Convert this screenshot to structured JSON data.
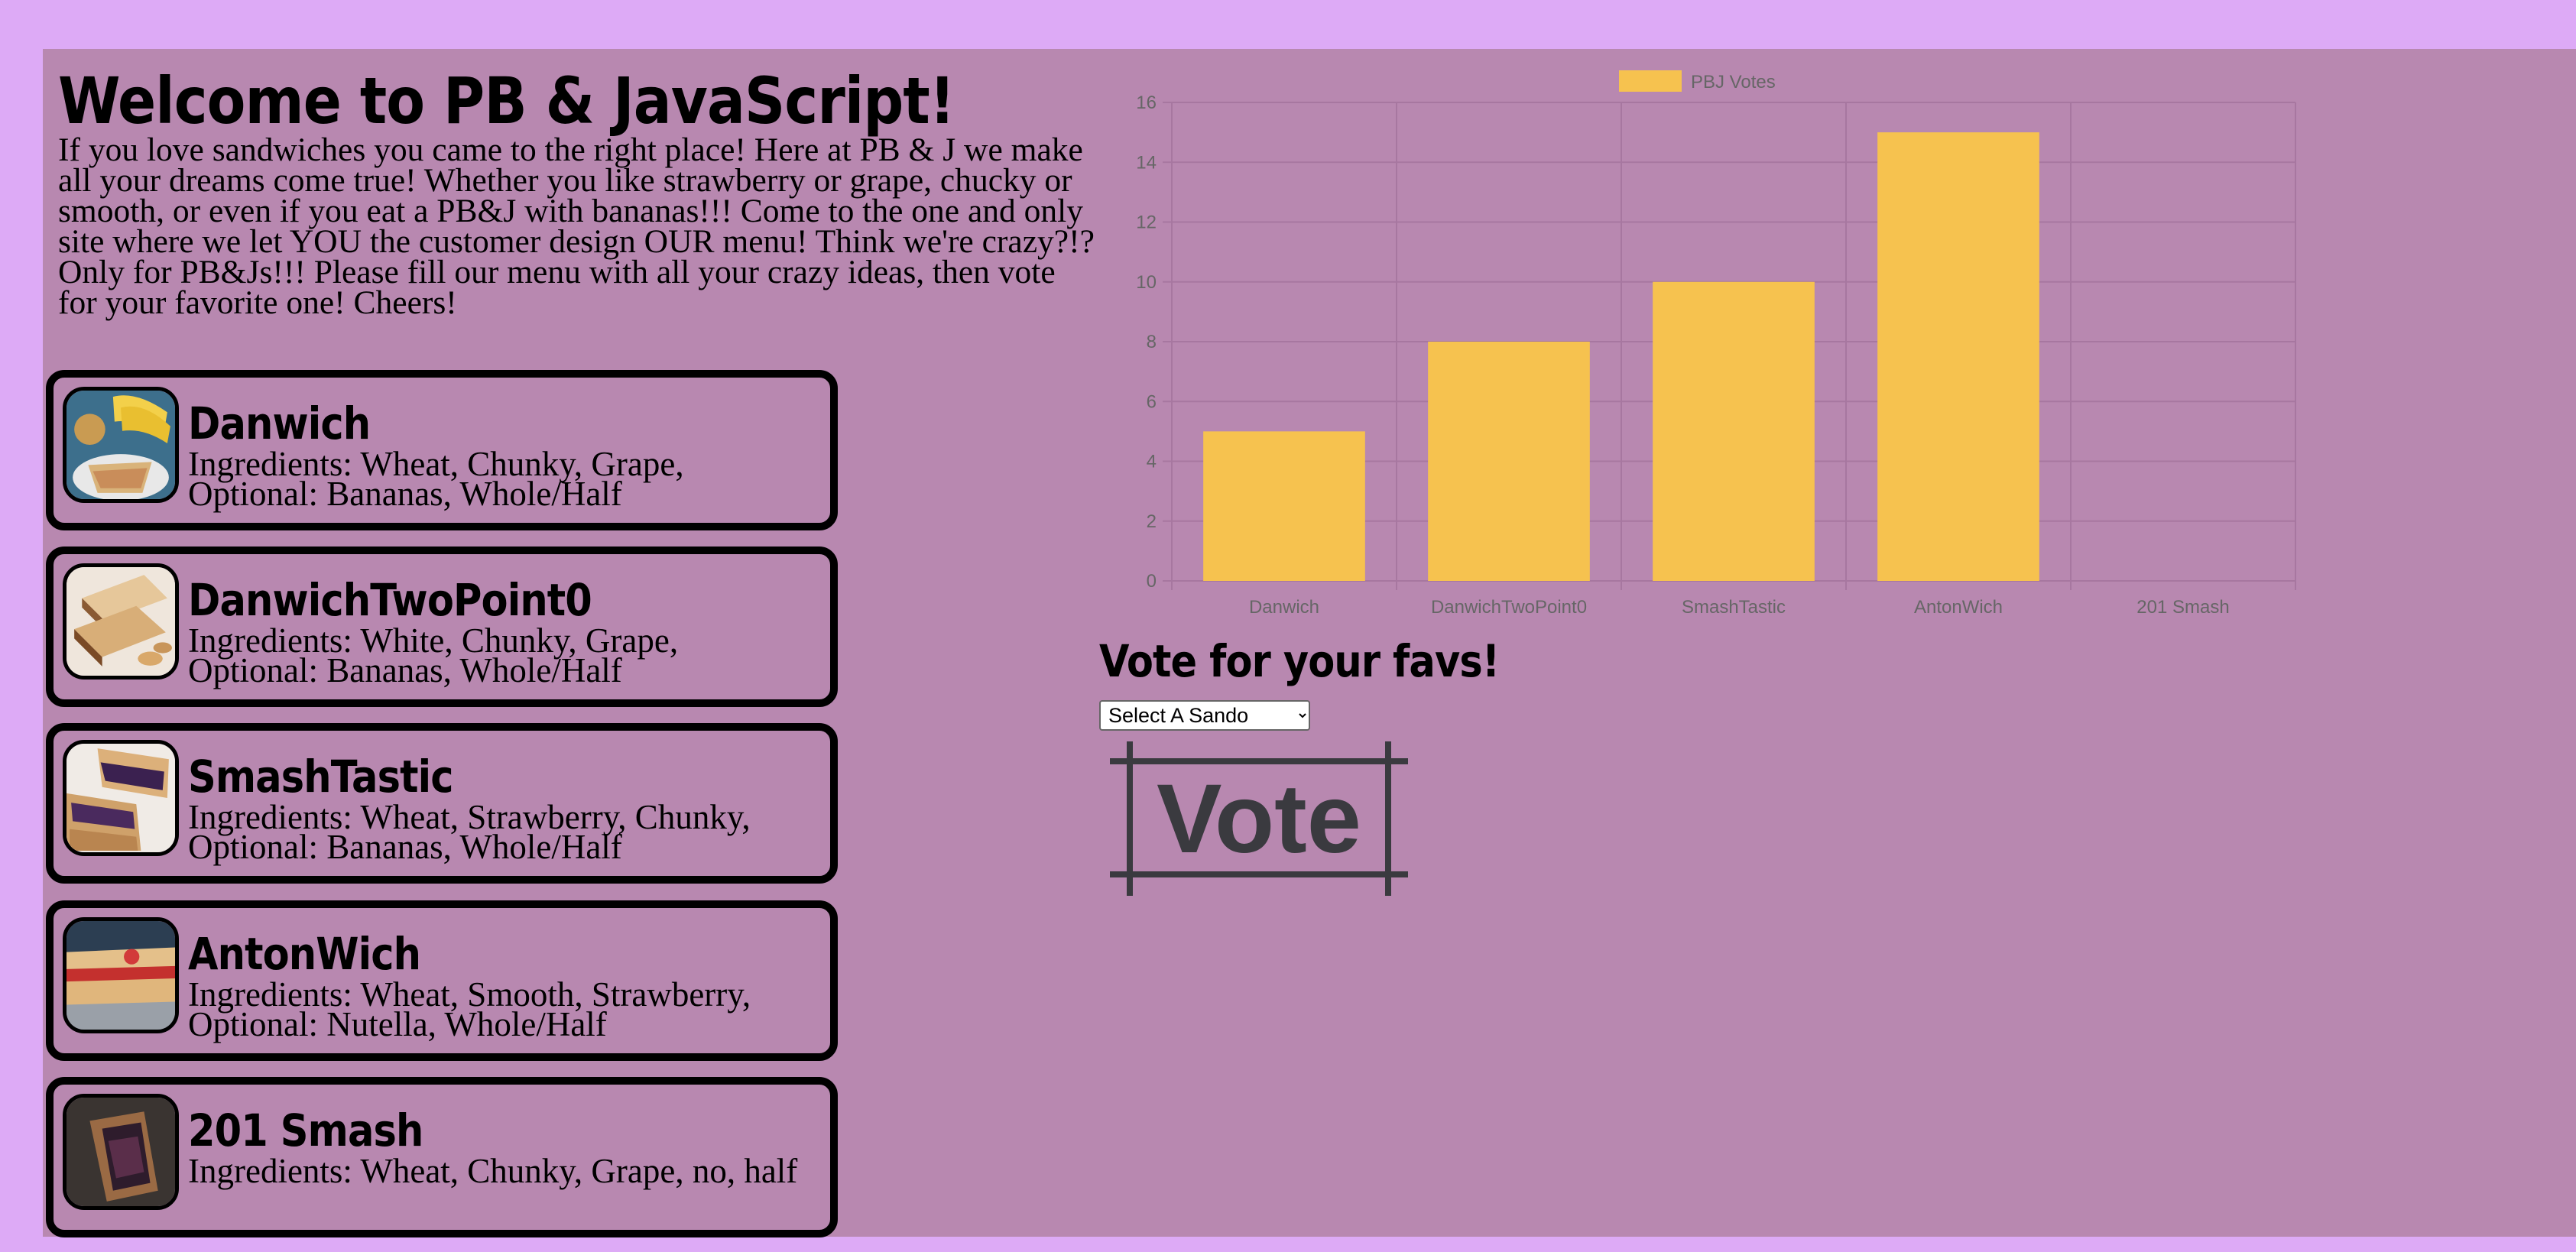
{
  "page": {
    "title": "Welcome to PB & JavaScript!",
    "intro": "If you love sandwiches you came to the right place! Here at PB & J we make all your dreams come true! Whether you like strawberry or grape, chucky or smooth, or even if you eat a PB&J with bananas!!! Come to the one and only site where we let YOU the customer design OUR menu! Think we're crazy?!? Only for PB&Js!!! Please fill our menu with all your crazy ideas, then vote for your favorite one! Cheers!"
  },
  "colors": {
    "page_background": "#ddaaf6",
    "panel_background": "#b888b0",
    "bar_fill": "#f6c24f",
    "grid": "#a777a0",
    "axis_text": "#666666"
  },
  "sandwiches": [
    {
      "name": "Danwich",
      "ingredients": "Ingredients: Wheat, Chunky, Grape, Optional: Bananas, Whole/Half",
      "image_icon": "sandwich-with-bananas-photo"
    },
    {
      "name": "DanwichTwoPoint0",
      "ingredients": "Ingredients: White, Chunky, Grape, Optional: Bananas, Whole/Half",
      "image_icon": "stacked-sandwich-photo"
    },
    {
      "name": "SmashTastic",
      "ingredients": "Ingredients: Wheat, Strawberry, Chunky, Optional: Bananas, Whole/Half",
      "image_icon": "jelly-sandwich-photo"
    },
    {
      "name": "AntonWich",
      "ingredients": "Ingredients: Wheat, Smooth, Strawberry, Optional: Nutella, Whole/Half",
      "image_icon": "strawberry-sandwich-photo"
    },
    {
      "name": "201 Smash",
      "ingredients": "Ingredients: Wheat, Chunky, Grape, no, half",
      "image_icon": "dark-sandwich-photo"
    }
  ],
  "chart_data": {
    "type": "bar",
    "categories": [
      "Danwich",
      "DanwichTwoPoint0",
      "SmashTastic",
      "AntonWich",
      "201 Smash"
    ],
    "series": [
      {
        "name": "PBJ Votes",
        "values": [
          5,
          8,
          10,
          15,
          0
        ]
      }
    ],
    "ylim": [
      0,
      16
    ],
    "yticks": [
      "0",
      "2",
      "4",
      "6",
      "8",
      "10",
      "12",
      "14",
      "16"
    ],
    "grid": true,
    "legend": "top-center"
  },
  "vote": {
    "heading": "Vote for your favs!",
    "select_value": "Select A Sando",
    "button_label": "Vote"
  }
}
